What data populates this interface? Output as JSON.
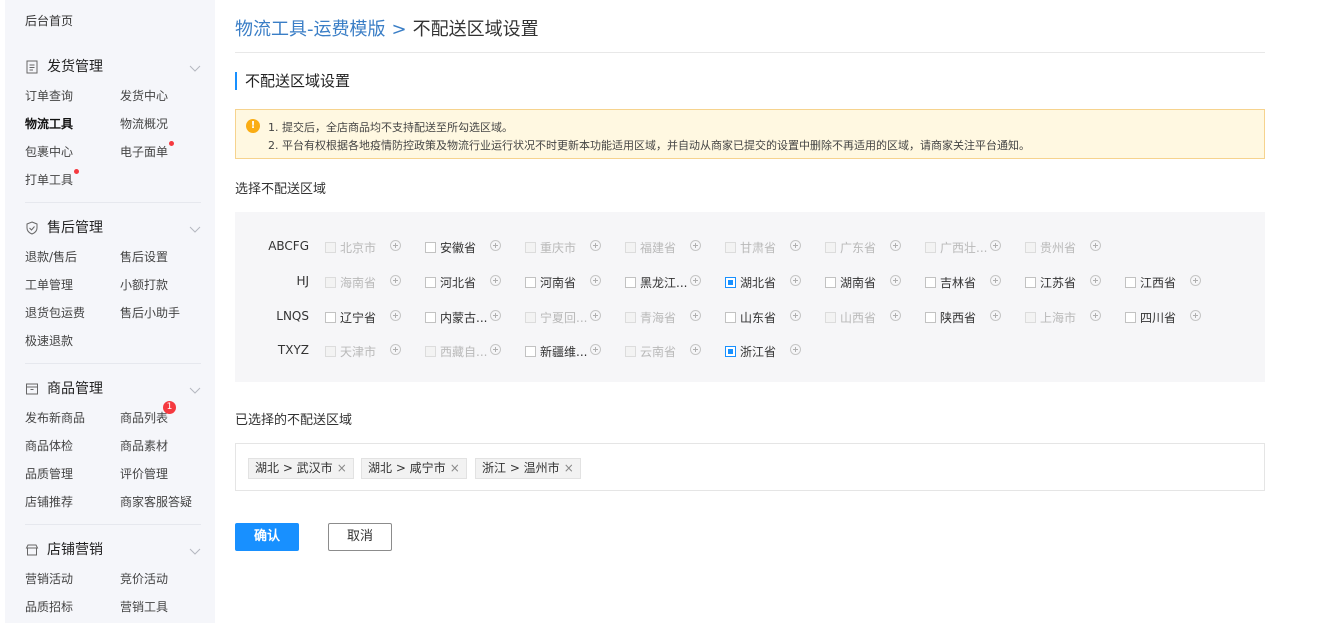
{
  "sidebar": {
    "home": "后台首页",
    "groups": [
      {
        "title": "发货管理",
        "icon": "document-icon",
        "items": [
          {
            "label": "订单查询"
          },
          {
            "label": "发货中心"
          },
          {
            "label": "物流工具",
            "active": true
          },
          {
            "label": "物流概况"
          },
          {
            "label": "包裹中心"
          },
          {
            "label": "电子面单",
            "dot": true
          },
          {
            "label": "打单工具",
            "dot": true
          }
        ]
      },
      {
        "title": "售后管理",
        "icon": "shield-check-icon",
        "items": [
          {
            "label": "退款/售后"
          },
          {
            "label": "售后设置"
          },
          {
            "label": "工单管理"
          },
          {
            "label": "小额打款"
          },
          {
            "label": "退货包运费"
          },
          {
            "label": "售后小助手"
          },
          {
            "label": "极速退款"
          }
        ]
      },
      {
        "title": "商品管理",
        "icon": "box-icon",
        "items": [
          {
            "label": "发布新商品"
          },
          {
            "label": "商品列表",
            "badge": "1"
          },
          {
            "label": "商品体检"
          },
          {
            "label": "商品素材"
          },
          {
            "label": "品质管理"
          },
          {
            "label": "评价管理"
          },
          {
            "label": "店铺推荐"
          },
          {
            "label": "商家客服答疑"
          }
        ]
      },
      {
        "title": "店铺营销",
        "icon": "shop-icon",
        "items": [
          {
            "label": "营销活动"
          },
          {
            "label": "竞价活动"
          },
          {
            "label": "品质招标"
          },
          {
            "label": "营销工具"
          }
        ]
      }
    ]
  },
  "breadcrumb": {
    "parent": "物流工具-运费模版",
    "separator": ">",
    "current": "不配送区域设置"
  },
  "section_title": "不配送区域设置",
  "notice": {
    "line1": "1. 提交后，全店商品均不支持配送至所勾选区域。",
    "line2": "2. 平台有权根据各地疫情防控政策及物流行业运行状况不时更新本功能适用区域，并自动从商家已提交的设置中删除不再适用的区域，请商家关注平台通知。"
  },
  "select_label": "选择不配送区域",
  "region_rows": [
    {
      "label": "ABCFG",
      "provinces": [
        {
          "name": "北京市",
          "state": "disabled"
        },
        {
          "name": "安徽省",
          "state": "enabled"
        },
        {
          "name": "重庆市",
          "state": "disabled"
        },
        {
          "name": "福建省",
          "state": "disabled"
        },
        {
          "name": "甘肃省",
          "state": "disabled"
        },
        {
          "name": "广东省",
          "state": "disabled"
        },
        {
          "name": "广西壮...",
          "state": "disabled"
        },
        {
          "name": "贵州省",
          "state": "disabled"
        }
      ]
    },
    {
      "label": "HJ",
      "provinces": [
        {
          "name": "海南省",
          "state": "disabled"
        },
        {
          "name": "河北省",
          "state": "enabled"
        },
        {
          "name": "河南省",
          "state": "enabled"
        },
        {
          "name": "黑龙江...",
          "state": "enabled"
        },
        {
          "name": "湖北省",
          "state": "partial"
        },
        {
          "name": "湖南省",
          "state": "enabled"
        },
        {
          "name": "吉林省",
          "state": "enabled"
        },
        {
          "name": "江苏省",
          "state": "enabled"
        },
        {
          "name": "江西省",
          "state": "enabled"
        }
      ]
    },
    {
      "label": "LNQS",
      "provinces": [
        {
          "name": "辽宁省",
          "state": "enabled"
        },
        {
          "name": "内蒙古...",
          "state": "enabled"
        },
        {
          "name": "宁夏回...",
          "state": "disabled"
        },
        {
          "name": "青海省",
          "state": "disabled"
        },
        {
          "name": "山东省",
          "state": "enabled"
        },
        {
          "name": "山西省",
          "state": "disabled"
        },
        {
          "name": "陕西省",
          "state": "enabled"
        },
        {
          "name": "上海市",
          "state": "disabled"
        },
        {
          "name": "四川省",
          "state": "enabled"
        }
      ]
    },
    {
      "label": "TXYZ",
      "provinces": [
        {
          "name": "天津市",
          "state": "disabled"
        },
        {
          "name": "西藏自...",
          "state": "disabled"
        },
        {
          "name": "新疆维...",
          "state": "enabled"
        },
        {
          "name": "云南省",
          "state": "disabled"
        },
        {
          "name": "浙江省",
          "state": "partial"
        }
      ]
    }
  ],
  "selected_label": "已选择的不配送区域",
  "selected_tags": [
    {
      "text": "湖北 > 武汉市"
    },
    {
      "text": "湖北 > 咸宁市"
    },
    {
      "text": "浙江 > 温州市"
    }
  ],
  "tag_close": "×",
  "buttons": {
    "confirm": "确认",
    "cancel": "取消"
  },
  "colors": {
    "primary": "#1890ff",
    "link": "#3a7ec6",
    "notice_bg": "#fff8e1",
    "badge": "#f5393f"
  }
}
